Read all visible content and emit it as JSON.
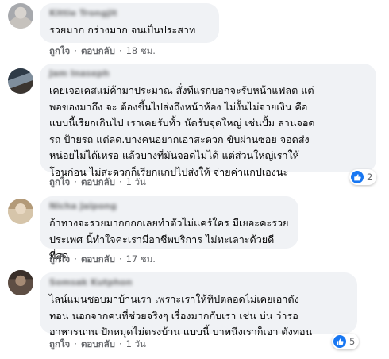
{
  "comments": [
    {
      "author": "Kittie Trongjit",
      "text": "รวยมาก กร่างมาก จนเป็นประสาท",
      "like_label": "ถูกใจ",
      "reply_label": "ตอบกลับ",
      "time": "18 ชม.",
      "reactions": null,
      "avatar_color": "#a7a9ad"
    },
    {
      "author": "Jam Inaseph",
      "text": "เคยเจอเคสแม่ค้ามาประมาณ สั่งทีแรกบอกจะรับหน้าแฟลต แต่\nพอของมาถึง จะ ต้องขึ้นไปส่งถึงหน้าห้อง ไม่งั้นไม่จ่ายเงิน คือ\nแบบนี้เรียกเกินไป เราเคยรับทั้ว นัดรับจุดใหญ่ เช่นปั้ม ลานจอด\nรถ ป้ายรถ แต่ลด.บางคนอยากเอาสะดวก ขับผ่านซอย จอดส่ง\nหน่อยไม่ได้เหรอ แล้วบางที่มันจอดไม่ได้ แต่ส่วนใหญ่เราให้\nโอนก่อน ไม่สะดวกก็เรียกแกปไปส่งให้ จ่ายค่าแกปเองนะ",
      "like_label": "ถูกใจ",
      "reply_label": "ตอบกลับ",
      "time": "1 วัน",
      "reactions": "2",
      "avatar_color": "#5a6a7a"
    },
    {
      "author": "Nicha Jaipong",
      "text": "ถ้าทางจะรวยมากกกกเลยทำตัวไม่แคร์ใคร มีเยอะคะรวย\nประเพศ นี้ทำใจคะเรามีอาชีพบริการ ไม่ทะเลาะด้วยดีที่สุด",
      "like_label": "ถูกใจ",
      "reply_label": "ตอบกลับ",
      "time": "17 ชม.",
      "reactions": null,
      "avatar_color": "#c9b89a"
    },
    {
      "author": "Somsak Kutphon",
      "text": "ไลน์แมนชอบมาบ้านเรา เพราะเราให้ทิปตลอดไม่เคยเอาตัง\nทอน นอกจากคนที่ช่วยจริงๆ เรื่องมากกับเรา เช่น บ่น ว่ารอ\nอาหารนาน ปักหมุดไม่ตรงบ้าน แบบนี้ บาทนึงเราก็เอา ตังทอน",
      "like_label": "ถูกใจ",
      "reply_label": "ตอบกลับ",
      "time": "1 วัน",
      "reactions": "5",
      "avatar_color": "#6b5a4e"
    }
  ],
  "colors": {
    "bubble": "#f0f2f5",
    "meta_text": "#65676b",
    "like_blue": "#1877f2"
  }
}
